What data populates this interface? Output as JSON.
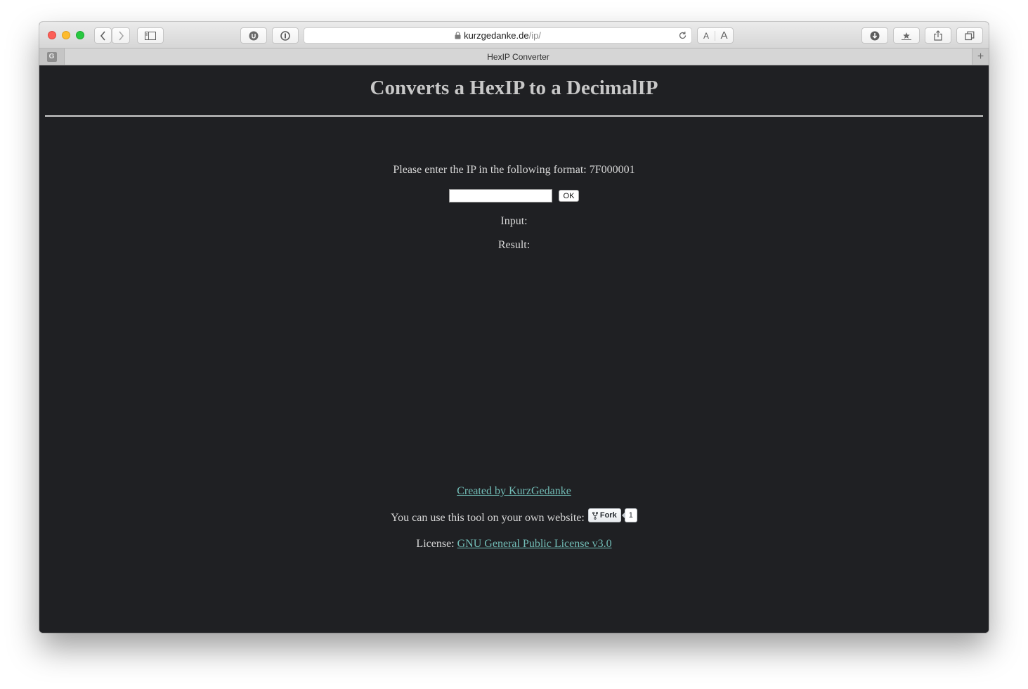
{
  "browser": {
    "url_host": "kurzgedanke.de",
    "url_path": "/ip/",
    "tab_title": "HexIP Converter",
    "tab_favicon_letter": "G",
    "font_small_label": "A",
    "font_large_label": "A",
    "new_tab_symbol": "+",
    "icons": {
      "close": "close-window-icon",
      "minimize": "minimize-window-icon",
      "maximize": "maximize-window-icon",
      "back": "chevron-left-icon",
      "forward": "chevron-right-icon",
      "sidebar": "sidebar-icon",
      "ublock": "ublock-extension-icon",
      "password": "password-manager-icon",
      "lock": "lock-icon",
      "reload": "reload-icon",
      "downloads": "download-icon",
      "bookmarks": "bookmarks-icon",
      "share": "share-icon",
      "tabs": "tab-overview-icon"
    }
  },
  "page": {
    "title": "Converts a HexIP to a DecimalIP",
    "instruction": "Please enter the IP in the following format: 7F000001",
    "input_value": "",
    "ok_label": "OK",
    "input_label": "Input:",
    "result_label": "Result:",
    "created_by": "Created by KurzGedanke",
    "use_text": "You can use this tool on your own website:",
    "fork_label": "Fork",
    "fork_count": "1",
    "license_label": "License:",
    "license_link": "GNU General Public License v3.0"
  },
  "colors": {
    "page_background": "#1f2023",
    "text": "#d7d7d7",
    "title": "#c8c8c8",
    "link": "#72bdb7"
  }
}
